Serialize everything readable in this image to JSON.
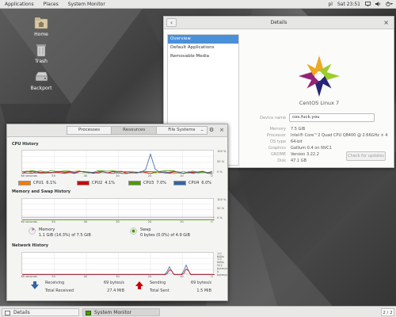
{
  "topbar": {
    "applications": "Applications",
    "places": "Places",
    "system_monitor": "System Monitor",
    "locale": "pl",
    "clock": "Sat 23:51"
  },
  "desktop": {
    "icons": [
      {
        "label": "Home"
      },
      {
        "label": "Trash"
      },
      {
        "label": "Backport"
      }
    ]
  },
  "details": {
    "title": "Details",
    "sidebar": [
      "Overview",
      "Default Applications",
      "Removable Media"
    ],
    "os_name": "CentOS Linux 7",
    "device_name_label": "Device name",
    "device_name_value": "cos.fuck.you",
    "rows": [
      {
        "key": "Memory",
        "value": "7.5 GiB"
      },
      {
        "key": "Processor",
        "value": "Intel® Core™2 Quad CPU Q8400 @ 2.66GHz × 4"
      },
      {
        "key": "OS type",
        "value": "64-bit"
      },
      {
        "key": "Graphics",
        "value": "Gallium 0.4 on NVC1"
      },
      {
        "key": "GNOME",
        "value": "Version 3.22.2"
      },
      {
        "key": "Disk",
        "value": "47.1 GB"
      }
    ],
    "update_button": "Check for updates",
    "colors": {
      "selection": "#4a90d9"
    }
  },
  "sysmon": {
    "tabs": [
      "Processes",
      "Resources",
      "File Systems"
    ],
    "active_tab": "Resources",
    "cpu": {
      "title": "CPU History",
      "y_ticks": [
        "100 %",
        "50 %",
        "0 %"
      ],
      "x_ticks": [
        "60 seconds",
        "50",
        "40",
        "30",
        "20",
        "10",
        "0"
      ],
      "legend": [
        {
          "name": "CPU1",
          "value": "6.1%",
          "color": "#f57900"
        },
        {
          "name": "CPU2",
          "value": "4.1%",
          "color": "#cc0000"
        },
        {
          "name": "CPU3",
          "value": "7.0%",
          "color": "#4e9a06"
        },
        {
          "name": "CPU4",
          "value": "6.0%",
          "color": "#3465a4"
        }
      ]
    },
    "memory": {
      "title": "Memory and Swap History",
      "y_ticks": [
        "100 %",
        "50 %",
        "0 %"
      ],
      "x_ticks": [
        "60 seconds",
        "50",
        "40",
        "30",
        "20",
        "10",
        "0"
      ],
      "memory_label": "Memory",
      "memory_value": "1.1 GiB (14.3%) of 7.5 GiB",
      "swap_label": "Swap",
      "swap_value": "0 bytes (0.0%) of 4.9 GiB",
      "memory_color": "#ad7fa8",
      "swap_color": "#4e9a06"
    },
    "network": {
      "title": "Network History",
      "y_ticks": [
        "1.0 KiB/s",
        "1.0 KiB/s",
        "512 bytes/s",
        "0 bytes/s"
      ],
      "x_ticks": [
        "60 seconds",
        "50",
        "40",
        "30",
        "20",
        "10",
        "0"
      ],
      "receiving_label": "Receiving",
      "receiving_rate": "69 bytes/s",
      "total_received_label": "Total Received",
      "total_received": "27.4 MiB",
      "sending_label": "Sending",
      "sending_rate": "69 bytes/s",
      "total_sent_label": "Total Sent",
      "total_sent": "1.5 MiB",
      "receiving_color": "#3465a4",
      "sending_color": "#cc0000"
    }
  },
  "bottombar": {
    "tasks": [
      "Details",
      "System Monitor"
    ],
    "pager": "2 / 2"
  }
}
